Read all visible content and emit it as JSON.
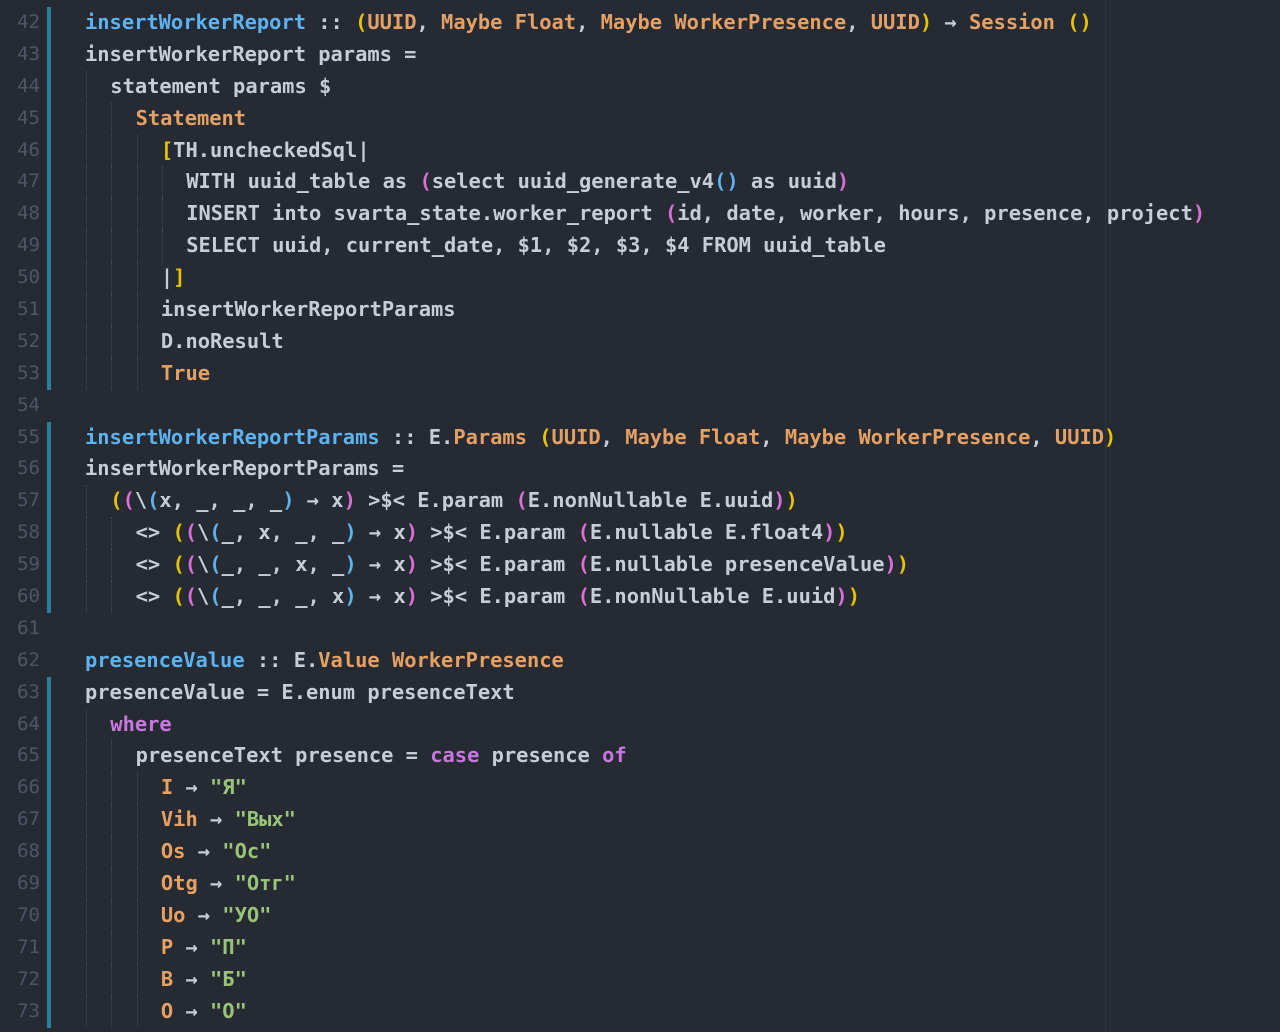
{
  "editor": {
    "colors": {
      "background": "#262a33",
      "plain": "#c8ccd4",
      "function": "#5cb3f0",
      "type": "#e5a063",
      "keyword": "#c678dd",
      "string": "#98c379",
      "paren1": "#e6c200",
      "paren2": "#da70d6",
      "paren3": "#5cb3f0",
      "operator": "#c8ccd4",
      "gutter": "#4e5666",
      "modified_marker": "#2a7f9a"
    },
    "lines": [
      {
        "number": "42",
        "marked": true,
        "indent": 0,
        "tokens": [
          {
            "t": "insertWorkerReport",
            "c": "function"
          },
          {
            "t": " :: ",
            "c": "operator"
          },
          {
            "t": "(",
            "c": "paren1"
          },
          {
            "t": "UUID",
            "c": "type"
          },
          {
            "t": ", ",
            "c": "plain"
          },
          {
            "t": "Maybe Float",
            "c": "type"
          },
          {
            "t": ", ",
            "c": "plain"
          },
          {
            "t": "Maybe WorkerPresence",
            "c": "type"
          },
          {
            "t": ", ",
            "c": "plain"
          },
          {
            "t": "UUID",
            "c": "type"
          },
          {
            "t": ")",
            "c": "paren1"
          },
          {
            "t": " → ",
            "c": "operator"
          },
          {
            "t": "Session",
            "c": "type"
          },
          {
            "t": " ",
            "c": "plain"
          },
          {
            "t": "()",
            "c": "paren1"
          }
        ]
      },
      {
        "number": "43",
        "marked": true,
        "indent": 0,
        "tokens": [
          {
            "t": "insertWorkerReport params =",
            "c": "plain"
          }
        ]
      },
      {
        "number": "44",
        "marked": true,
        "indent": 1,
        "tokens": [
          {
            "t": "statement params $",
            "c": "plain"
          }
        ]
      },
      {
        "number": "45",
        "marked": true,
        "indent": 2,
        "tokens": [
          {
            "t": "Statement",
            "c": "type"
          }
        ]
      },
      {
        "number": "46",
        "marked": true,
        "indent": 3,
        "tokens": [
          {
            "t": "[",
            "c": "paren1"
          },
          {
            "t": "TH.uncheckedSql|",
            "c": "plain"
          }
        ]
      },
      {
        "number": "47",
        "marked": true,
        "indent": 4,
        "tokens": [
          {
            "t": "WITH uuid_table as ",
            "c": "plain"
          },
          {
            "t": "(",
            "c": "paren2"
          },
          {
            "t": "select uuid_generate_v4",
            "c": "plain"
          },
          {
            "t": "()",
            "c": "paren3"
          },
          {
            "t": " as uuid",
            "c": "plain"
          },
          {
            "t": ")",
            "c": "paren2"
          }
        ]
      },
      {
        "number": "48",
        "marked": true,
        "indent": 4,
        "tokens": [
          {
            "t": "INSERT into svarta_state.worker_report ",
            "c": "plain"
          },
          {
            "t": "(",
            "c": "paren2"
          },
          {
            "t": "id, date, worker, hours, presence, project",
            "c": "plain"
          },
          {
            "t": ")",
            "c": "paren2"
          }
        ]
      },
      {
        "number": "49",
        "marked": true,
        "indent": 4,
        "tokens": [
          {
            "t": "SELECT uuid, current_date, $1, $2, $3, $4 FROM uuid_table",
            "c": "plain"
          }
        ]
      },
      {
        "number": "50",
        "marked": true,
        "indent": 3,
        "tokens": [
          {
            "t": "|",
            "c": "plain"
          },
          {
            "t": "]",
            "c": "paren1"
          }
        ]
      },
      {
        "number": "51",
        "marked": true,
        "indent": 3,
        "tokens": [
          {
            "t": "insertWorkerReportParams",
            "c": "plain"
          }
        ]
      },
      {
        "number": "52",
        "marked": true,
        "indent": 3,
        "tokens": [
          {
            "t": "D.noResult",
            "c": "plain"
          }
        ]
      },
      {
        "number": "53",
        "marked": true,
        "indent": 3,
        "tokens": [
          {
            "t": "True",
            "c": "type"
          }
        ]
      },
      {
        "number": "54",
        "marked": false,
        "indent": 0,
        "tokens": []
      },
      {
        "number": "55",
        "marked": true,
        "indent": 0,
        "tokens": [
          {
            "t": "insertWorkerReportParams",
            "c": "function"
          },
          {
            "t": " :: ",
            "c": "operator"
          },
          {
            "t": "E.",
            "c": "plain"
          },
          {
            "t": "Params",
            "c": "type"
          },
          {
            "t": " ",
            "c": "plain"
          },
          {
            "t": "(",
            "c": "paren1"
          },
          {
            "t": "UUID",
            "c": "type"
          },
          {
            "t": ", ",
            "c": "plain"
          },
          {
            "t": "Maybe Float",
            "c": "type"
          },
          {
            "t": ", ",
            "c": "plain"
          },
          {
            "t": "Maybe WorkerPresence",
            "c": "type"
          },
          {
            "t": ", ",
            "c": "plain"
          },
          {
            "t": "UUID",
            "c": "type"
          },
          {
            "t": ")",
            "c": "paren1"
          }
        ]
      },
      {
        "number": "56",
        "marked": true,
        "indent": 0,
        "tokens": [
          {
            "t": "insertWorkerReportParams =",
            "c": "plain"
          }
        ]
      },
      {
        "number": "57",
        "marked": true,
        "indent": 1,
        "tokens": [
          {
            "t": "(",
            "c": "paren1"
          },
          {
            "t": "(",
            "c": "paren2"
          },
          {
            "t": "\\",
            "c": "plain"
          },
          {
            "t": "(",
            "c": "paren3"
          },
          {
            "t": "x, _, _, _",
            "c": "plain"
          },
          {
            "t": ")",
            "c": "paren3"
          },
          {
            "t": " → x",
            "c": "plain"
          },
          {
            "t": ")",
            "c": "paren2"
          },
          {
            "t": " >$< E.param ",
            "c": "plain"
          },
          {
            "t": "(",
            "c": "paren2"
          },
          {
            "t": "E.nonNullable E.uuid",
            "c": "plain"
          },
          {
            "t": ")",
            "c": "paren2"
          },
          {
            "t": ")",
            "c": "paren1"
          }
        ]
      },
      {
        "number": "58",
        "marked": true,
        "indent": 2,
        "tokens": [
          {
            "t": "<> ",
            "c": "plain"
          },
          {
            "t": "(",
            "c": "paren1"
          },
          {
            "t": "(",
            "c": "paren2"
          },
          {
            "t": "\\",
            "c": "plain"
          },
          {
            "t": "(",
            "c": "paren3"
          },
          {
            "t": "_, x, _, _",
            "c": "plain"
          },
          {
            "t": ")",
            "c": "paren3"
          },
          {
            "t": " → x",
            "c": "plain"
          },
          {
            "t": ")",
            "c": "paren2"
          },
          {
            "t": " >$< E.param ",
            "c": "plain"
          },
          {
            "t": "(",
            "c": "paren2"
          },
          {
            "t": "E.nullable E.float4",
            "c": "plain"
          },
          {
            "t": ")",
            "c": "paren2"
          },
          {
            "t": ")",
            "c": "paren1"
          }
        ]
      },
      {
        "number": "59",
        "marked": true,
        "indent": 2,
        "tokens": [
          {
            "t": "<> ",
            "c": "plain"
          },
          {
            "t": "(",
            "c": "paren1"
          },
          {
            "t": "(",
            "c": "paren2"
          },
          {
            "t": "\\",
            "c": "plain"
          },
          {
            "t": "(",
            "c": "paren3"
          },
          {
            "t": "_, _, x, _",
            "c": "plain"
          },
          {
            "t": ")",
            "c": "paren3"
          },
          {
            "t": " → x",
            "c": "plain"
          },
          {
            "t": ")",
            "c": "paren2"
          },
          {
            "t": " >$< E.param ",
            "c": "plain"
          },
          {
            "t": "(",
            "c": "paren2"
          },
          {
            "t": "E.nullable presenceValue",
            "c": "plain"
          },
          {
            "t": ")",
            "c": "paren2"
          },
          {
            "t": ")",
            "c": "paren1"
          }
        ]
      },
      {
        "number": "60",
        "marked": true,
        "indent": 2,
        "tokens": [
          {
            "t": "<> ",
            "c": "plain"
          },
          {
            "t": "(",
            "c": "paren1"
          },
          {
            "t": "(",
            "c": "paren2"
          },
          {
            "t": "\\",
            "c": "plain"
          },
          {
            "t": "(",
            "c": "paren3"
          },
          {
            "t": "_, _, _, x",
            "c": "plain"
          },
          {
            "t": ")",
            "c": "paren3"
          },
          {
            "t": " → x",
            "c": "plain"
          },
          {
            "t": ")",
            "c": "paren2"
          },
          {
            "t": " >$< E.param ",
            "c": "plain"
          },
          {
            "t": "(",
            "c": "paren2"
          },
          {
            "t": "E.nonNullable E.uuid",
            "c": "plain"
          },
          {
            "t": ")",
            "c": "paren2"
          },
          {
            "t": ")",
            "c": "paren1"
          }
        ]
      },
      {
        "number": "61",
        "marked": false,
        "indent": 0,
        "tokens": []
      },
      {
        "number": "62",
        "marked": false,
        "indent": 0,
        "tokens": [
          {
            "t": "presenceValue",
            "c": "function"
          },
          {
            "t": " :: ",
            "c": "operator"
          },
          {
            "t": "E.",
            "c": "plain"
          },
          {
            "t": "Value WorkerPresence",
            "c": "type"
          }
        ]
      },
      {
        "number": "63",
        "marked": true,
        "indent": 0,
        "tokens": [
          {
            "t": "presenceValue = E.enum presenceText",
            "c": "plain"
          }
        ]
      },
      {
        "number": "64",
        "marked": true,
        "indent": 1,
        "tokens": [
          {
            "t": "where",
            "c": "keyword"
          }
        ]
      },
      {
        "number": "65",
        "marked": true,
        "indent": 2,
        "tokens": [
          {
            "t": "presenceText presence = ",
            "c": "plain"
          },
          {
            "t": "case",
            "c": "keyword"
          },
          {
            "t": " presence ",
            "c": "plain"
          },
          {
            "t": "of",
            "c": "keyword"
          }
        ]
      },
      {
        "number": "66",
        "marked": true,
        "indent": 3,
        "tokens": [
          {
            "t": "I",
            "c": "type"
          },
          {
            "t": " → ",
            "c": "plain"
          },
          {
            "t": "\"Я\"",
            "c": "string"
          }
        ]
      },
      {
        "number": "67",
        "marked": true,
        "indent": 3,
        "tokens": [
          {
            "t": "Vih",
            "c": "type"
          },
          {
            "t": " → ",
            "c": "plain"
          },
          {
            "t": "\"Вых\"",
            "c": "string"
          }
        ]
      },
      {
        "number": "68",
        "marked": true,
        "indent": 3,
        "tokens": [
          {
            "t": "Os",
            "c": "type"
          },
          {
            "t": " → ",
            "c": "plain"
          },
          {
            "t": "\"Ос\"",
            "c": "string"
          }
        ]
      },
      {
        "number": "69",
        "marked": true,
        "indent": 3,
        "tokens": [
          {
            "t": "Otg",
            "c": "type"
          },
          {
            "t": " → ",
            "c": "plain"
          },
          {
            "t": "\"Отг\"",
            "c": "string"
          }
        ]
      },
      {
        "number": "70",
        "marked": true,
        "indent": 3,
        "tokens": [
          {
            "t": "Uo",
            "c": "type"
          },
          {
            "t": " → ",
            "c": "plain"
          },
          {
            "t": "\"УО\"",
            "c": "string"
          }
        ]
      },
      {
        "number": "71",
        "marked": true,
        "indent": 3,
        "tokens": [
          {
            "t": "P",
            "c": "type"
          },
          {
            "t": " → ",
            "c": "plain"
          },
          {
            "t": "\"П\"",
            "c": "string"
          }
        ]
      },
      {
        "number": "72",
        "marked": true,
        "indent": 3,
        "tokens": [
          {
            "t": "B",
            "c": "type"
          },
          {
            "t": " → ",
            "c": "plain"
          },
          {
            "t": "\"Б\"",
            "c": "string"
          }
        ]
      },
      {
        "number": "73",
        "marked": true,
        "indent": 3,
        "tokens": [
          {
            "t": "O",
            "c": "type"
          },
          {
            "t": " → ",
            "c": "plain"
          },
          {
            "t": "\"О\"",
            "c": "string"
          }
        ]
      }
    ]
  }
}
